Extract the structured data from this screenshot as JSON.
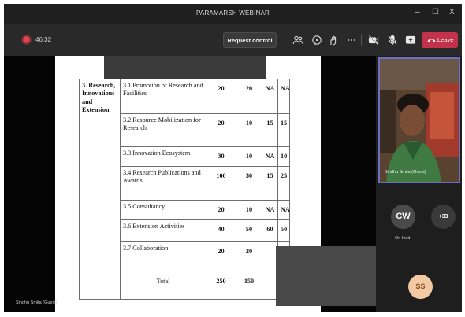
{
  "window": {
    "title": "PARAMARSH WEBINAR",
    "controls": {
      "minimize": "–",
      "maximize": "☐",
      "close": "X"
    }
  },
  "toolbar": {
    "timer": "46:32",
    "request_control_label": "Request control",
    "leave_label": "Leave",
    "icons": [
      "people-icon",
      "chat-icon",
      "react-icon",
      "more-icon",
      "camera-off-icon",
      "mic-off-icon",
      "share-icon",
      "phone-icon"
    ],
    "leave_color": "#c4314b"
  },
  "shared_document": {
    "criterion": "3. Research, Innovations and Extension",
    "rows": [
      {
        "item": "3.1 Promotion of Research and Facilities",
        "c1": "20",
        "c2": "20",
        "c3": "NA",
        "c4": "NA"
      },
      {
        "item": "3.2 Resource Mobilization for Research",
        "c1": "20",
        "c2": "10",
        "c3": "15",
        "c4": "15"
      },
      {
        "item": "3.3 Innovation Ecosystem",
        "c1": "30",
        "c2": "10",
        "c3": "NA",
        "c4": "10"
      },
      {
        "item": "3.4 Research Publications and Awards",
        "c1": "100",
        "c2": "30",
        "c3": "15",
        "c4": "25"
      },
      {
        "item": "3.5 Consultancy",
        "c1": "20",
        "c2": "10",
        "c3": "NA",
        "c4": "NA"
      },
      {
        "item": "3.6 Extension Activities",
        "c1": "40",
        "c2": "50",
        "c3": "60",
        "c4": "50"
      },
      {
        "item": "3.7 Collaboration",
        "c1": "20",
        "c2": "20",
        "c3": "",
        "c4": ""
      }
    ],
    "total": {
      "label": "Total",
      "c1": "250",
      "c2": "150"
    }
  },
  "stage": {
    "presenter_name": "Sindhu Smita (Guest)"
  },
  "participants": {
    "video_name": "Sindhu Smita (Guest)",
    "cw_initials": "CW",
    "cw_status": "On hold",
    "more_count": "+33",
    "ss_initials": "SS"
  }
}
